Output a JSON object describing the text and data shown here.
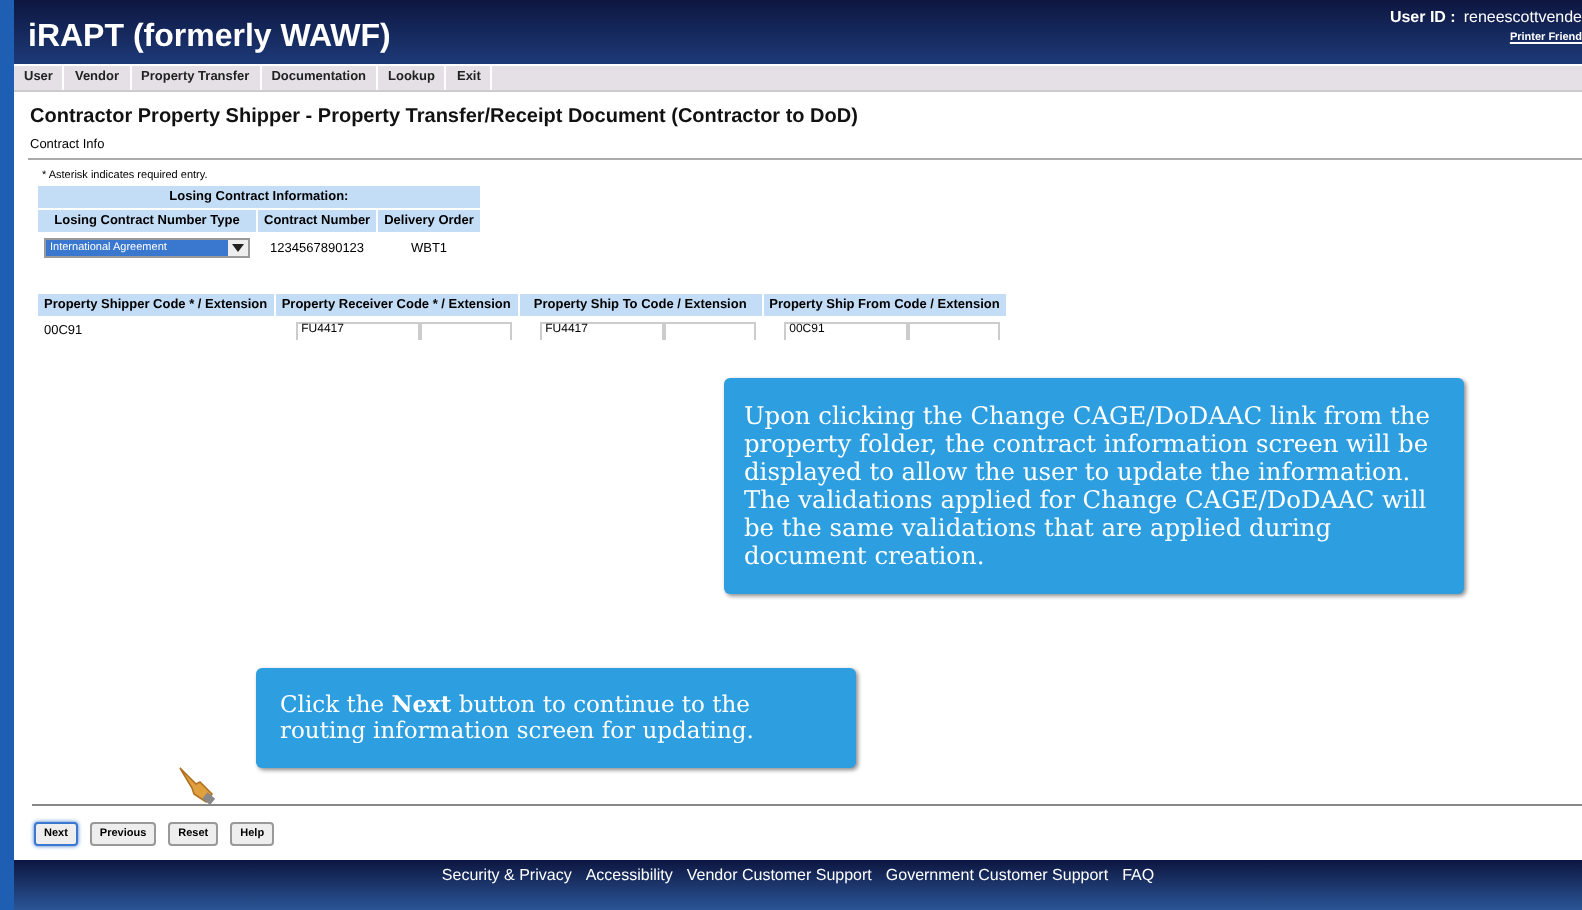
{
  "header": {
    "title": "iRAPT (formerly WAWF)",
    "user_label": "User ID :",
    "user_id": "reneescottvende",
    "printer_link": "Printer Friend"
  },
  "menu": [
    "User",
    "Vendor",
    "Property Transfer",
    "Documentation",
    "Lookup",
    "Exit"
  ],
  "page_title": "Contractor Property Shipper - Property Transfer/Receipt Document (Contractor to DoD)",
  "section": "Contract Info",
  "required_note": "* Asterisk indicates required entry.",
  "losing_contract": {
    "heading": "Losing Contract Information:",
    "columns": [
      "Losing Contract Number Type",
      "Contract Number",
      "Delivery Order"
    ],
    "type_value": "International Agreement",
    "contract_number": "1234567890123",
    "delivery_order": "WBT1"
  },
  "codes": {
    "columns": [
      "Property Shipper Code * / Extension",
      "Property Receiver Code * / Extension",
      "Property Ship To Code / Extension",
      "Property Ship From Code / Extension"
    ],
    "cells": [
      {
        "kind": "text",
        "value": "00C91"
      },
      {
        "kind": "fields",
        "value": "FU4417"
      },
      {
        "kind": "fields",
        "value": "FU4417"
      },
      {
        "kind": "fields",
        "value": "00C91"
      }
    ]
  },
  "callouts": [
    {
      "text": "Upon clicking the Change CAGE/DoDAAC link from the property folder, the contract information screen will be displayed to allow the user to update the information. The validations applied for Change CAGE/DoDAAC will be the same validations that are applied during document creation."
    },
    {
      "text": "Click the **Next** button to continue to the routing information screen for updating."
    }
  ],
  "buttons": [
    {
      "label": "Next",
      "selected": true
    },
    {
      "label": "Previous",
      "selected": false
    },
    {
      "label": "Reset",
      "selected": false
    },
    {
      "label": "Help",
      "selected": false
    }
  ],
  "footer": [
    "Security & Privacy",
    "Accessibility",
    "Vendor Customer Support",
    "Government Customer Support",
    "FAQ"
  ]
}
